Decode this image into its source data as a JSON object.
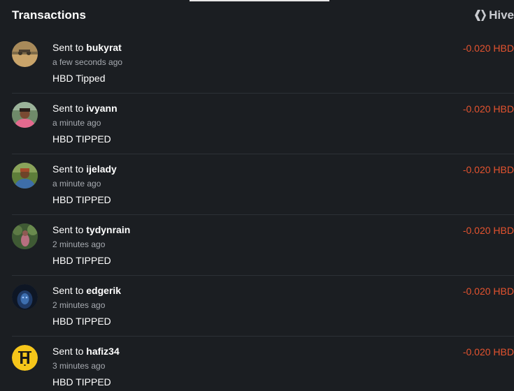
{
  "header": {
    "title": "Transactions",
    "brand_label": "Hive"
  },
  "colors": {
    "background": "#1b1e22",
    "divider": "#2d3137",
    "amount_negative": "#e4532f",
    "muted_text": "#a7abb1"
  },
  "transactions": [
    {
      "prefix": "Sent to",
      "user": "bukyrat",
      "time": "a few seconds ago",
      "memo": "HBD Tipped",
      "amount": "-0.020 HBD",
      "avatar": "photo-landscape"
    },
    {
      "prefix": "Sent to",
      "user": "ivyann",
      "time": "a minute ago",
      "memo": "HBD TIPPED",
      "amount": "-0.020 HBD",
      "avatar": "photo-person-pink"
    },
    {
      "prefix": "Sent to",
      "user": "ijelady",
      "time": "a minute ago",
      "memo": "HBD TIPPED",
      "amount": "-0.020 HBD",
      "avatar": "photo-person-blue"
    },
    {
      "prefix": "Sent to",
      "user": "tydynrain",
      "time": "2 minutes ago",
      "memo": "HBD TIPPED",
      "amount": "-0.020 HBD",
      "avatar": "photo-plants"
    },
    {
      "prefix": "Sent to",
      "user": "edgerik",
      "time": "2 minutes ago",
      "memo": "HBD TIPPED",
      "amount": "-0.020 HBD",
      "avatar": "photo-dark-hooded"
    },
    {
      "prefix": "Sent to",
      "user": "hafiz34",
      "time": "3 minutes ago",
      "memo": "HBD TIPPED",
      "amount": "-0.020 HBD",
      "avatar": "logo-h-yellow"
    }
  ]
}
